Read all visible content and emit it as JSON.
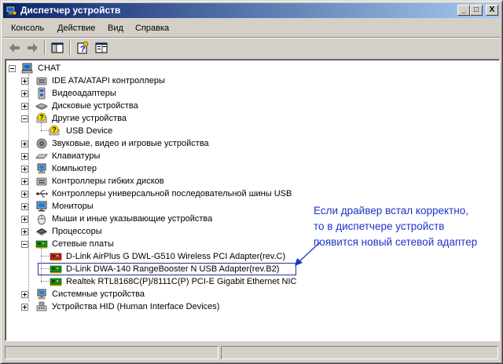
{
  "window": {
    "title": "Диспетчер устройств",
    "minimize": "_",
    "maximize": "□",
    "close": "X"
  },
  "menu": {
    "items": [
      {
        "label": "Консоль",
        "access": "К"
      },
      {
        "label": "Действие",
        "access": "Д"
      },
      {
        "label": "Вид",
        "access": "В"
      },
      {
        "label": "Справка",
        "access": "С"
      }
    ]
  },
  "tree": {
    "root": "CHAT",
    "items": [
      {
        "label": "IDE ATA/ATAPI контроллеры",
        "icon": "ide-controller-icon"
      },
      {
        "label": "Видеоадаптеры",
        "icon": "display-adapter-icon"
      },
      {
        "label": "Дисковые устройства",
        "icon": "disk-drive-icon"
      },
      {
        "label": "Другие устройства",
        "icon": "unknown-device-icon",
        "expanded": true,
        "children": [
          {
            "label": "USB Device",
            "icon": "unknown-device-icon"
          }
        ]
      },
      {
        "label": "Звуковые, видео и игровые устройства",
        "icon": "speaker-icon"
      },
      {
        "label": "Клавиатуры",
        "icon": "keyboard-icon"
      },
      {
        "label": "Компьютер",
        "icon": "computer-icon"
      },
      {
        "label": "Контроллеры гибких дисков",
        "icon": "floppy-controller-icon"
      },
      {
        "label": "Контроллеры универсальной последовательной шины USB",
        "icon": "usb-icon"
      },
      {
        "label": "Мониторы",
        "icon": "monitor-icon"
      },
      {
        "label": "Мыши и иные указывающие устройства",
        "icon": "mouse-icon"
      },
      {
        "label": "Процессоры",
        "icon": "cpu-icon"
      },
      {
        "label": "Сетевые платы",
        "icon": "network-card-icon",
        "expanded": true,
        "children": [
          {
            "label": "D-Link AirPlus G DWL-G510 Wireless PCI Adapter(rev.C)",
            "icon": "network-card-icon"
          },
          {
            "label": "D-Link DWA-140 RangeBooster N USB Adapter(rev.B2)",
            "icon": "network-card-icon"
          },
          {
            "label": "Realtek RTL8168C(P)/8111C(P) PCI-E Gigabit Ethernet NIC",
            "icon": "network-card-icon"
          }
        ]
      },
      {
        "label": "Системные устройства",
        "icon": "system-device-icon"
      },
      {
        "label": "Устройства HID (Human Interface Devices)",
        "icon": "hid-icon"
      }
    ]
  },
  "annotation": {
    "lines": [
      "Если драйвер встал корректно,",
      "то в диспетчере устройств",
      "появится новый сетевой адаптер"
    ],
    "color": "#1c34c8"
  }
}
